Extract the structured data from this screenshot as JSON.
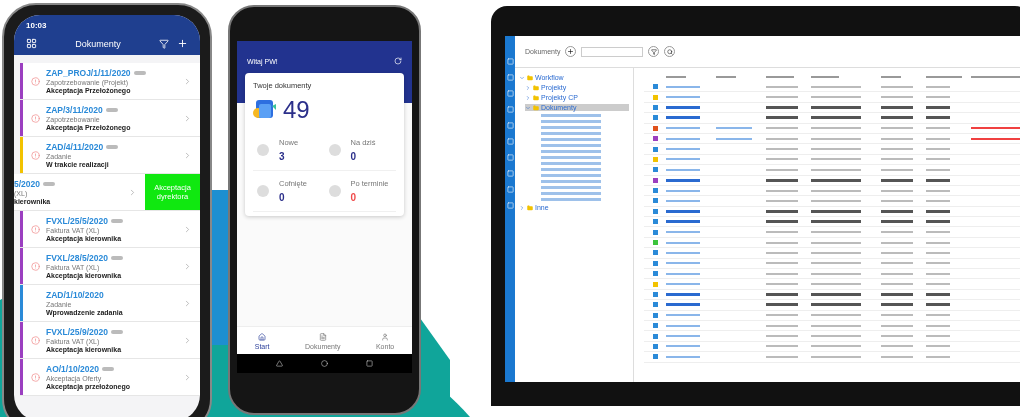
{
  "phone_ios": {
    "time": "10:03",
    "title": "Dokumenty",
    "documents": [
      {
        "number": "ZAP_PROJ/1/11/2020",
        "type": "Zapotrzebowanie (Projekt)",
        "status": "Akceptacja Przełożonego",
        "color": "#9b3fc0",
        "alert": true,
        "swiped": false
      },
      {
        "number": "ZAP/3/11/2020",
        "type": "Zapotrzebowanie",
        "status": "Akceptacja Przełożonego",
        "color": "#9b3fc0",
        "alert": true,
        "swiped": false
      },
      {
        "number": "ZAD/4/11/2020",
        "type": "Zadanie",
        "status": "W trakcie realizacji",
        "color": "#f2c200",
        "alert": true,
        "swiped": false
      },
      {
        "number": "5/2020",
        "type": "(XL)",
        "status": "kierownika",
        "swiped": true,
        "action": "Akceptacja dyrektora"
      },
      {
        "number": "FVXL/25/5/2020",
        "type": "Faktura VAT (XL)",
        "status": "Akceptacja kierownika",
        "color": "#9b3fc0",
        "alert": true,
        "swiped": false
      },
      {
        "number": "FVXL/28/5/2020",
        "type": "Faktura VAT (XL)",
        "status": "Akceptacja kierownika",
        "color": "#9b3fc0",
        "alert": true,
        "swiped": false
      },
      {
        "number": "ZAD/1/10/2020",
        "type": "Zadanie",
        "status": "Wprowadzenie zadania",
        "color": "#2a8ad8",
        "alert": false,
        "swiped": false
      },
      {
        "number": "FVXL/25/9/2020",
        "type": "Faktura VAT (XL)",
        "status": "Akceptacja kierownika",
        "color": "#9b3fc0",
        "alert": true,
        "swiped": false
      },
      {
        "number": "AO/1/10/2020",
        "type": "Akceptacja Oferty",
        "status": "Akceptacja przełożonego",
        "color": "#9b3fc0",
        "alert": true,
        "swiped": false
      }
    ]
  },
  "phone_android": {
    "greeting": "Witaj PW!",
    "card_title": "Twoje dokumenty",
    "total": "49",
    "stats": [
      {
        "label": "Nowe",
        "value": "3",
        "overdue": false
      },
      {
        "label": "Na dziś",
        "value": "0",
        "overdue": false
      },
      {
        "label": "Cofnięte",
        "value": "0",
        "overdue": false
      },
      {
        "label": "Po terminie",
        "value": "0",
        "overdue": true
      }
    ],
    "nav": [
      {
        "label": "Start",
        "selected": true,
        "kind": "home"
      },
      {
        "label": "Dokumenty",
        "selected": false,
        "kind": "doc"
      },
      {
        "label": "Konto",
        "selected": false,
        "kind": "user"
      }
    ]
  },
  "laptop": {
    "title": "Dokumenty",
    "tree": [
      {
        "label": "Workflow",
        "expanded": true,
        "selected": false,
        "children": [
          {
            "label": "Projekty",
            "expanded": false,
            "selected": false
          },
          {
            "label": "Projekty CP",
            "expanded": false,
            "selected": false
          },
          {
            "label": "Dokumenty",
            "expanded": true,
            "selected": true
          }
        ]
      },
      {
        "label": "Inne",
        "expanded": false,
        "selected": false
      }
    ],
    "rows": [
      {
        "color": "#2a8ad8",
        "bold": false,
        "alert": false
      },
      {
        "color": "#f2c200",
        "bold": false,
        "alert": false
      },
      {
        "color": "#2a8ad8",
        "bold": true,
        "alert": false
      },
      {
        "color": "#2a8ad8",
        "bold": true,
        "alert": false
      },
      {
        "color": "#e0521c",
        "bold": false,
        "alert": true
      },
      {
        "color": "#9b3fc0",
        "bold": false,
        "alert": true
      },
      {
        "color": "#2a8ad8",
        "bold": false,
        "alert": false
      },
      {
        "color": "#f2c200",
        "bold": false,
        "alert": false
      },
      {
        "color": "#2a8ad8",
        "bold": false,
        "alert": false
      },
      {
        "color": "#9b3fc0",
        "bold": true,
        "alert": false
      },
      {
        "color": "#2a8ad8",
        "bold": false,
        "alert": false
      },
      {
        "color": "#2a8ad8",
        "bold": false,
        "alert": false
      },
      {
        "color": "#2a8ad8",
        "bold": true,
        "alert": false
      },
      {
        "color": "#2a8ad8",
        "bold": true,
        "alert": false
      },
      {
        "color": "#2a8ad8",
        "bold": false,
        "alert": false
      },
      {
        "color": "#3cc43c",
        "bold": false,
        "alert": false
      },
      {
        "color": "#2a8ad8",
        "bold": false,
        "alert": false
      },
      {
        "color": "#2a8ad8",
        "bold": false,
        "alert": false
      },
      {
        "color": "#2a8ad8",
        "bold": false,
        "alert": false
      },
      {
        "color": "#f2c200",
        "bold": false,
        "alert": false
      },
      {
        "color": "#2a8ad8",
        "bold": true,
        "alert": false
      },
      {
        "color": "#2a8ad8",
        "bold": true,
        "alert": false
      },
      {
        "color": "#2a8ad8",
        "bold": false,
        "alert": false
      },
      {
        "color": "#2a8ad8",
        "bold": false,
        "alert": false
      },
      {
        "color": "#2a8ad8",
        "bold": false,
        "alert": false
      },
      {
        "color": "#2a8ad8",
        "bold": false,
        "alert": false
      },
      {
        "color": "#2a8ad8",
        "bold": false,
        "alert": false
      }
    ]
  }
}
